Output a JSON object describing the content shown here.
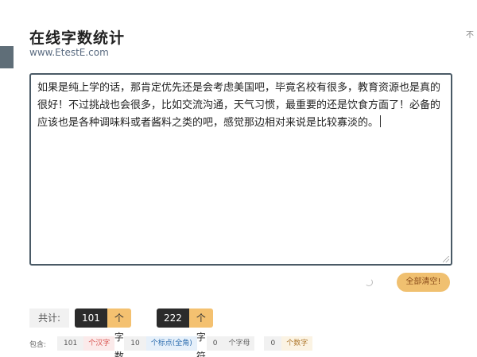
{
  "header": {
    "title": "在线字数统计",
    "site": "www.EtestE.com",
    "corner_text": "不"
  },
  "editor": {
    "text": "如果是纯上学的话，那肯定优先还是会考虑美国吧，毕竟名校有很多，教育资源也是真的很好！不过挑战也会很多，比如交流沟通，天气习惯，最重要的还是饮食方面了！必备的应该也是各种调味料或者酱料之类的吧，感觉那边相对来说是比较寡淡的。"
  },
  "actions": {
    "clear_label": "全部清空!"
  },
  "totals": {
    "label": "共计:",
    "chars_value": "101",
    "chars_unit": "个字数",
    "symbols_value": "222",
    "symbols_unit": "个字符"
  },
  "breakdown": {
    "label": "包含:",
    "items": [
      {
        "value": "101",
        "unit": "个汉字"
      },
      {
        "value": "10",
        "unit": "个标点(全角)"
      },
      {
        "value": "0",
        "unit": "个字母"
      },
      {
        "value": "0",
        "unit": "个数字"
      }
    ]
  },
  "colors": {
    "accent": "#f4c170",
    "editor_border": "#4a5a66",
    "dark_pill": "#2b2b2b"
  }
}
